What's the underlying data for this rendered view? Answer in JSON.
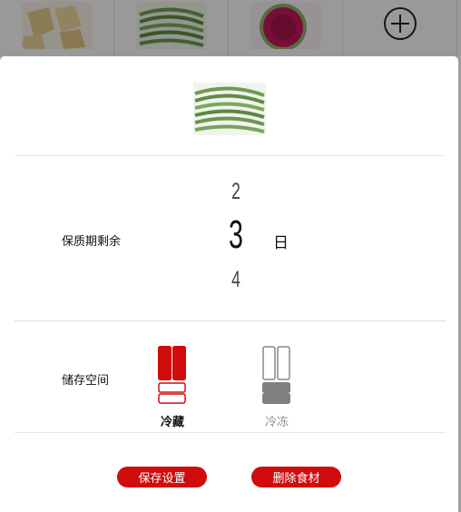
{
  "background_strip": {
    "items": [
      {
        "name": "food-thumb-1",
        "icon": "potato-icon"
      },
      {
        "name": "food-thumb-2",
        "icon": "green-beans-icon"
      },
      {
        "name": "food-thumb-3",
        "icon": "radish-icon"
      }
    ],
    "add_icon": "plus-circle-icon"
  },
  "detail": {
    "image_icon": "green-beans-icon",
    "shelf_life": {
      "label": "保质期剩余",
      "prev": "2",
      "current": "3",
      "next": "4",
      "unit": "日"
    },
    "storage": {
      "label": "储存空间",
      "options": [
        {
          "label": "冷藏",
          "icon": "fridge-compartment-icon",
          "selected": true
        },
        {
          "label": "冷冻",
          "icon": "freezer-compartment-icon",
          "selected": false
        }
      ]
    },
    "actions": {
      "save_label": "保存设置",
      "delete_label": "删除食材"
    }
  },
  "colors": {
    "accent": "#d00c0c",
    "inactive": "#8f8f8f"
  }
}
